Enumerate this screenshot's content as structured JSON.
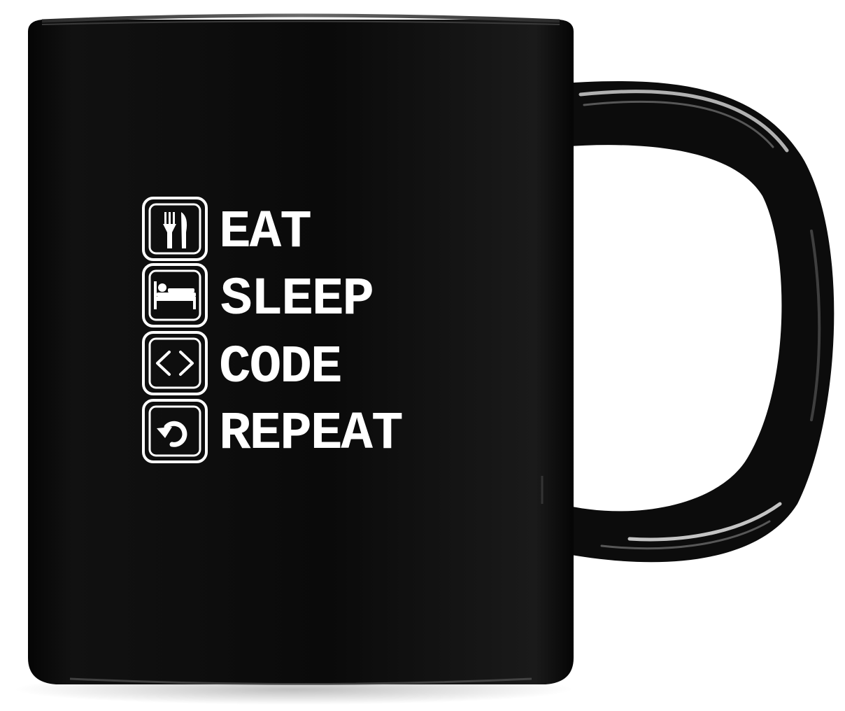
{
  "mug": {
    "body_color": "#0b0b0b",
    "print_color": "#ffffff",
    "background_color": "#ffffff"
  },
  "print": {
    "rows": [
      {
        "icon": "fork-knife-icon",
        "label": "EAT"
      },
      {
        "icon": "bed-icon",
        "label": "SLEEP"
      },
      {
        "icon": "code-brackets-icon",
        "label": "CODE"
      },
      {
        "icon": "repeat-arrow-icon",
        "label": "REPEAT"
      }
    ]
  }
}
